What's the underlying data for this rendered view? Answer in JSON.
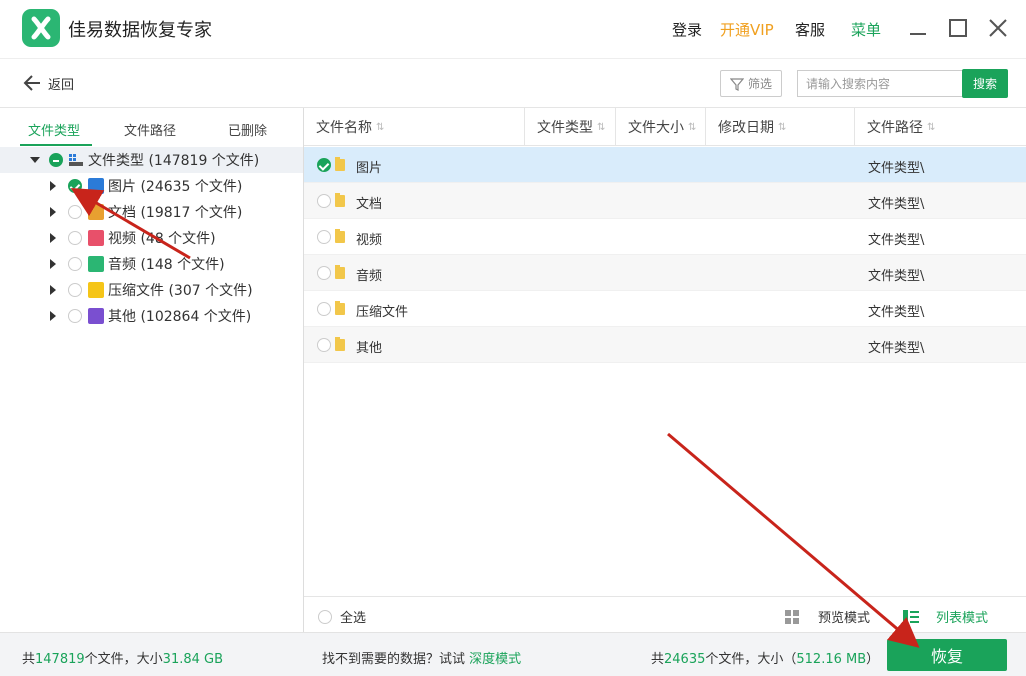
{
  "app": {
    "title": "佳易数据恢复专家",
    "login": "登录",
    "vip": "开通VIP",
    "service": "客服",
    "menu": "菜单"
  },
  "toolbar": {
    "back_label": "返回",
    "filter_label": "筛选",
    "search_placeholder": "请输入搜索内容",
    "search_button": "搜索"
  },
  "left_tabs": [
    "文件类型",
    "文件路径",
    "已删除"
  ],
  "tree": {
    "root": "文件类型 (147819 个文件)",
    "children": [
      {
        "label": "图片 (24635 个文件)",
        "checked": true,
        "icon_color": "#2b7bd8"
      },
      {
        "label": "文档 (19817 个文件)",
        "checked": false,
        "icon_color": "#e8a030"
      },
      {
        "label": "视频 (48 个文件)",
        "checked": false,
        "icon_color": "#e8506a"
      },
      {
        "label": "音频 (148 个文件)",
        "checked": false,
        "icon_color": "#2bb673"
      },
      {
        "label": "压缩文件 (307 个文件)",
        "checked": false,
        "icon_color": "#f5c518"
      },
      {
        "label": "其他 (102864 个文件)",
        "checked": false,
        "icon_color": "#7a4fd0"
      }
    ]
  },
  "table": {
    "columns": [
      "文件名称",
      "文件类型",
      "文件大小",
      "修改日期",
      "文件路径"
    ],
    "rows": [
      {
        "name": "图片",
        "path": "文件类型\\",
        "checked": true
      },
      {
        "name": "文档",
        "path": "文件类型\\",
        "checked": false
      },
      {
        "name": "视频",
        "path": "文件类型\\",
        "checked": false
      },
      {
        "name": "音频",
        "path": "文件类型\\",
        "checked": false
      },
      {
        "name": "压缩文件",
        "path": "文件类型\\",
        "checked": false
      },
      {
        "name": "其他",
        "path": "文件类型\\",
        "checked": false
      }
    ]
  },
  "bottom": {
    "select_all": "全选",
    "preview_mode": "预览模式",
    "list_mode": "列表模式"
  },
  "status": {
    "total_prefix": "共",
    "total_count": "147819",
    "total_mid": "个文件，大小",
    "total_size": "31.84 GB",
    "hint": "找不到需要的数据？试试",
    "deep_mode": "深度模式",
    "sel_prefix": "共",
    "sel_count": "24635",
    "sel_mid": "个文件，大小（",
    "sel_size": "512.16 MB",
    "sel_suffix": "）",
    "recover": "恢复"
  },
  "colors": {
    "accent": "#1aa35a",
    "vip": "#f0a020",
    "selected_row": "#d9ecfb",
    "arrow": "#c8241b"
  }
}
